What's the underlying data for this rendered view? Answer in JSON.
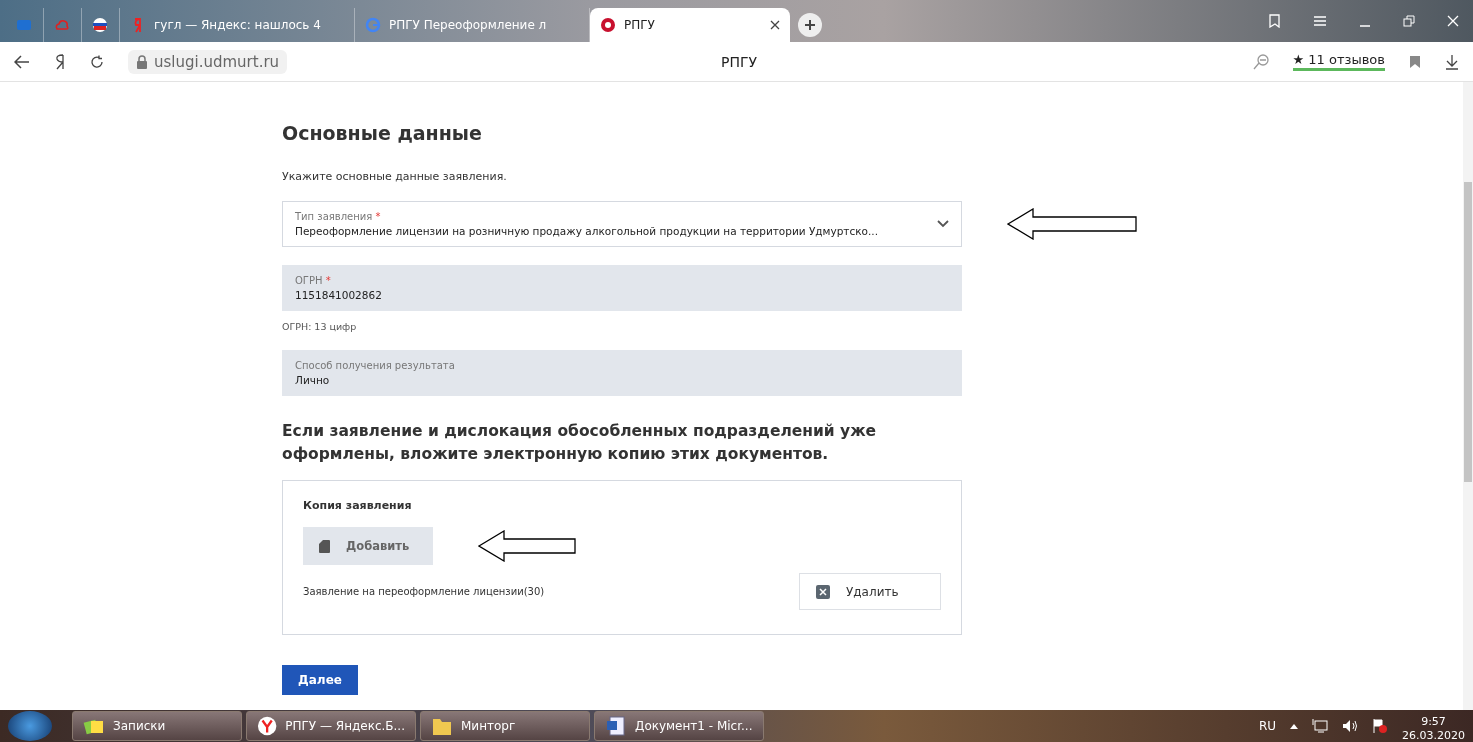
{
  "browser": {
    "tabs": [
      {
        "kind": "icon",
        "selected": false
      },
      {
        "kind": "icon",
        "selected": false
      },
      {
        "kind": "icon",
        "selected": false
      },
      {
        "kind": "text",
        "label": "гугл — Яндекс: нашлось 4",
        "selected": false
      },
      {
        "kind": "text",
        "label": "РПГУ Переоформление л",
        "selected": false
      },
      {
        "kind": "text",
        "label": "РПГУ",
        "selected": true
      }
    ],
    "address": "uslugi.udmurt.ru",
    "page_title": "РПГУ",
    "reviews": "★ 11 отзывов"
  },
  "form": {
    "title": "Основные данные",
    "subtitle": "Укажите основные данные заявления.",
    "fields": [
      {
        "kind": "select",
        "label": "Тип заявления",
        "required_mark": "*",
        "value": "Переоформление лицензии на розничную продажу алкогольной продукции на территории Удмуртско...",
        "annotated": true
      },
      {
        "kind": "readonly",
        "label": "ОГРН",
        "required_mark": "*",
        "value": "1151841002862",
        "hint": "ОГРН: 13 цифр",
        "annotated": false
      },
      {
        "kind": "readonly",
        "label": "Способ получения результата",
        "value": "Лично",
        "annotated": false
      }
    ],
    "upload_heading": "Если заявление и дислокация обособленных подразделений уже оформлены, вложите электронную копию этих документов.",
    "upload": {
      "title": "Копия заявления",
      "add_button": "Добавить",
      "file_name": "Заявление на переоформление лицензии(30)",
      "delete_button": "Удалить"
    },
    "next_button": "Далее"
  },
  "taskbar": {
    "items": [
      {
        "label": "Записки"
      },
      {
        "label": "РПГУ — Яндекс.Б..."
      },
      {
        "label": "Минторг"
      },
      {
        "label": "Документ1 - Micr..."
      }
    ],
    "language": "RU",
    "time": "9:57",
    "date": "26.03.2020"
  }
}
